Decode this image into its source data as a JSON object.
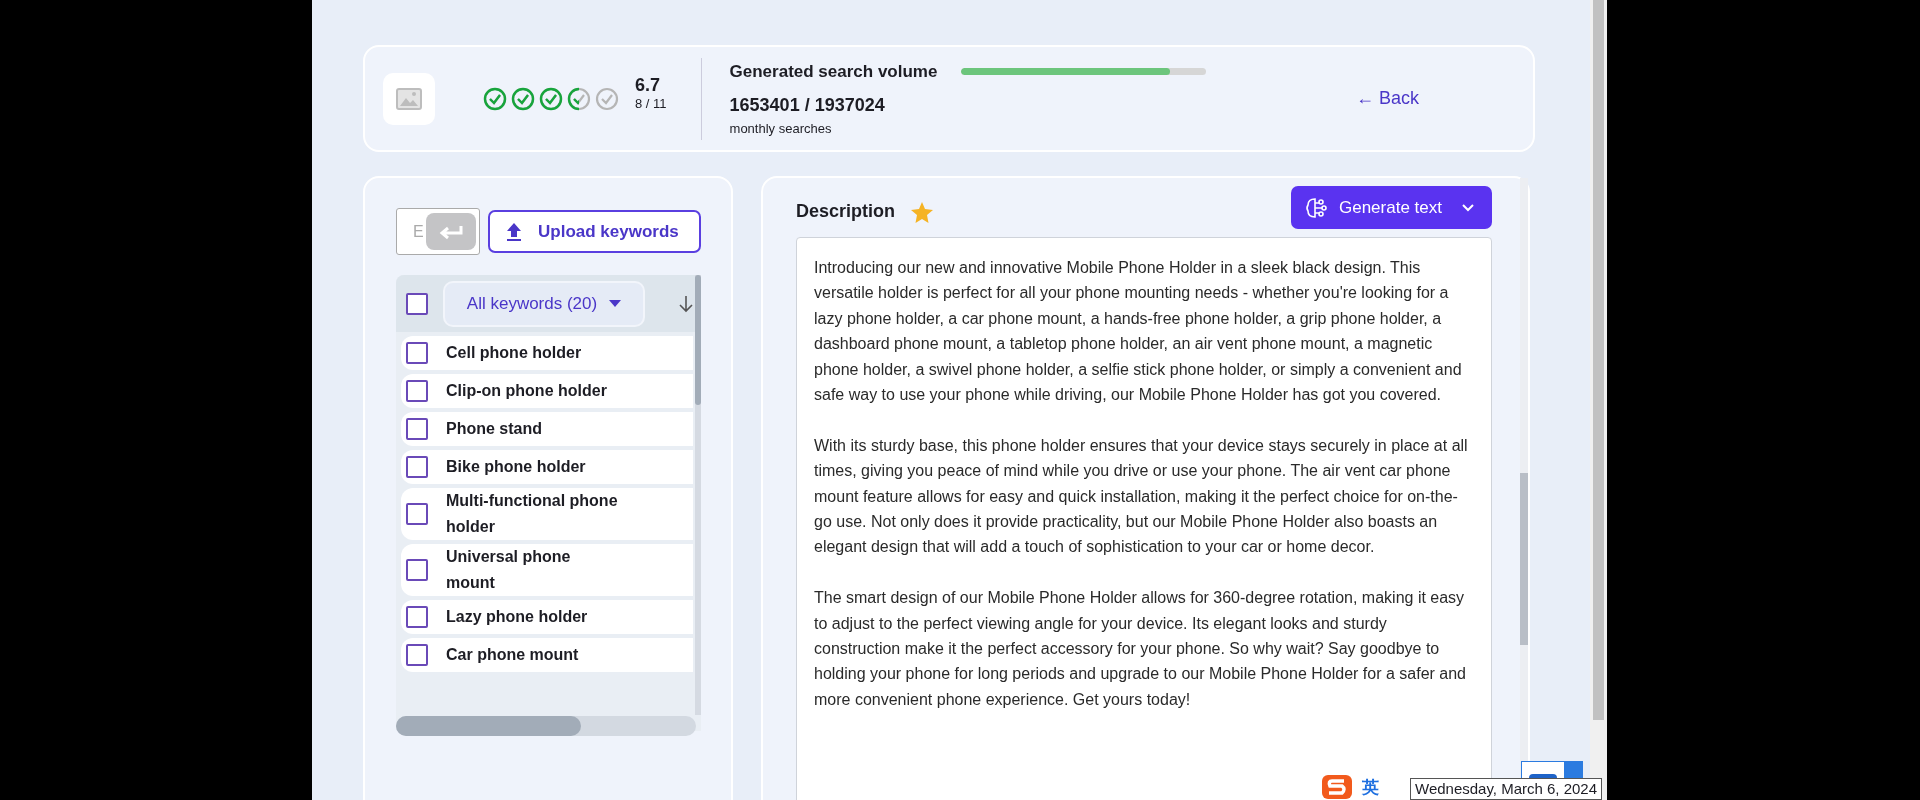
{
  "rating": {
    "checks": [
      {
        "kind": "full"
      },
      {
        "kind": "full"
      },
      {
        "kind": "full"
      },
      {
        "kind": "half"
      },
      {
        "kind": "empty"
      }
    ],
    "score": "6.7",
    "count": "8 / 11"
  },
  "search_volume": {
    "label": "Generated search volume",
    "level": 0.85,
    "value": "1653401 / 1937024",
    "unit": "monthly searches"
  },
  "back_link": "← Back",
  "keyword_panel": {
    "input": {
      "placeholder": "E"
    },
    "upload_button": "Upload keywords",
    "select_all": {
      "checked": false
    },
    "filter": "All keywords (20)",
    "keywords": [
      {
        "label": "Cell phone holder",
        "checked": false
      },
      {
        "label": "Clip-on phone holder",
        "checked": false
      },
      {
        "label": "Phone stand",
        "checked": false
      },
      {
        "label": "Bike phone holder",
        "checked": false
      },
      {
        "label": "Multi-functional phone holder",
        "checked": false
      },
      {
        "label": "Universal phone mount",
        "checked": false
      },
      {
        "label": "Lazy phone holder",
        "checked": false
      },
      {
        "label": "Car phone mount",
        "checked": false
      }
    ]
  },
  "description": {
    "title": "Description",
    "starred": true,
    "generate_button": "Generate text",
    "paragraphs": [
      "Introducing our new and innovative Mobile Phone Holder in a sleek black design. This versatile holder is perfect for all your phone mounting needs - whether you're looking for a lazy phone holder, a car phone mount, a hands-free phone holder, a grip phone holder, a dashboard phone mount, a tabletop phone holder, an air vent phone mount, a magnetic phone holder, a swivel phone holder, a selfie stick phone holder, or simply a convenient and safe way to use your phone while driving, our Mobile Phone Holder has got you covered.",
      "With its sturdy base, this phone holder ensures that your device stays securely in place at all times, giving you peace of mind while you drive or use your phone. The air vent car phone mount feature allows for easy and quick installation, making it the perfect choice for on-the-go use. Not only does it provide practicality, but our Mobile Phone Holder also boasts an elegant design that will add a touch of sophistication to your car or home decor.",
      "The smart design of our Mobile Phone Holder allows for 360-degree rotation, making it easy to adjust to the perfect viewing angle for your device. Its elegant looks and sturdy construction make it the perfect accessory for your phone. So why wait? Say goodbye to holding your phone for long periods and upgrade to our Mobile Phone Holder for a safer and more convenient phone experience. Get yours today!"
    ]
  },
  "ime": {
    "language": "英"
  },
  "tooltip": "Wednesday, March 6, 2024"
}
